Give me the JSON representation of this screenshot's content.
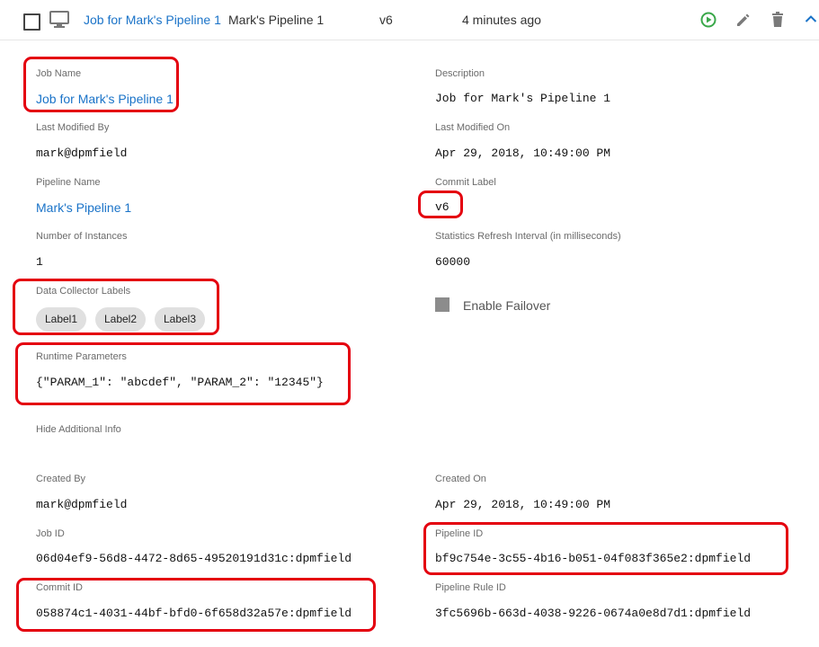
{
  "header": {
    "job_link": "Job for Mark's Pipeline 1",
    "pipeline": "Mark's Pipeline 1",
    "version": "v6",
    "time": "4 minutes ago"
  },
  "fields": {
    "job_name": {
      "label": "Job Name",
      "value": "Job for Mark's Pipeline 1"
    },
    "description": {
      "label": "Description",
      "value": "Job for Mark's Pipeline 1"
    },
    "last_modified_by": {
      "label": "Last Modified By",
      "value": "mark@dpmfield"
    },
    "last_modified_on": {
      "label": "Last Modified On",
      "value": "Apr 29, 2018, 10:49:00 PM"
    },
    "pipeline_name": {
      "label": "Pipeline Name",
      "value": "Mark's Pipeline 1"
    },
    "commit_label": {
      "label": "Commit Label",
      "value": "v6"
    },
    "num_instances": {
      "label": "Number of Instances",
      "value": "1"
    },
    "stats_refresh": {
      "label": "Statistics Refresh Interval (in milliseconds)",
      "value": "60000"
    },
    "dc_labels": {
      "label": "Data Collector Labels",
      "chips": [
        "Label1",
        "Label2",
        "Label3"
      ]
    },
    "enable_failover": {
      "label": "Enable Failover"
    },
    "runtime_params": {
      "label": "Runtime Parameters",
      "value": "{\"PARAM_1\": \"abcdef\", \"PARAM_2\": \"12345\"}"
    },
    "hide_info": "Hide Additional Info",
    "created_by": {
      "label": "Created By",
      "value": "mark@dpmfield"
    },
    "created_on": {
      "label": "Created On",
      "value": "Apr 29, 2018, 10:49:00 PM"
    },
    "job_id": {
      "label": "Job ID",
      "value": "06d04ef9-56d8-4472-8d65-49520191d31c:dpmfield"
    },
    "pipeline_id": {
      "label": "Pipeline ID",
      "value": "bf9c754e-3c55-4b16-b051-04f083f365e2:dpmfield"
    },
    "commit_id": {
      "label": "Commit ID",
      "value": "058874c1-4031-44bf-bfd0-6f658d32a57e:dpmfield"
    },
    "pipeline_rule_id": {
      "label": "Pipeline Rule ID",
      "value": "3fc5696b-663d-4038-9226-0674a0e8d7d1:dpmfield"
    }
  },
  "icons": {
    "monitor": "monitor-icon",
    "play": "play-circle-icon",
    "edit": "pencil-icon",
    "delete": "trash-icon",
    "collapse": "chevron-up-icon"
  },
  "colors": {
    "link": "#1a73c8",
    "play": "#3aa84a",
    "highlight": "#e4000f"
  }
}
